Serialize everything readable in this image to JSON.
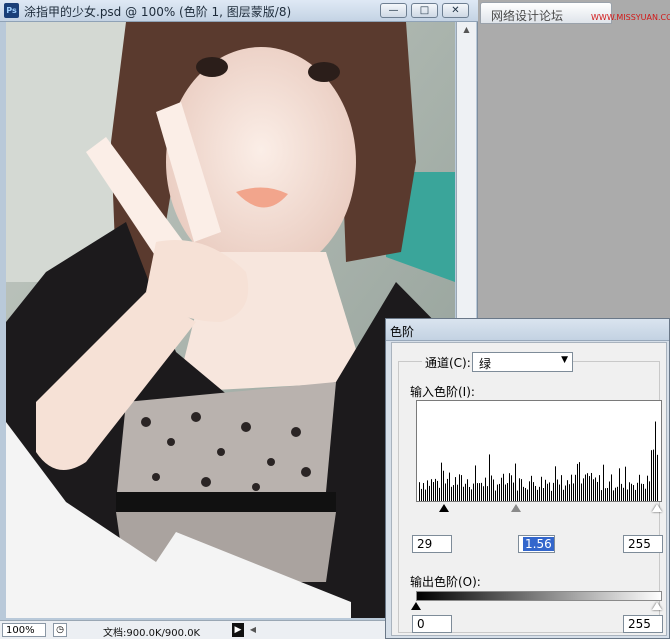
{
  "document": {
    "title": "涂指甲的少女.psd @ 100% (色阶 1, 图层蒙版/8)",
    "app_icon": "Ps",
    "window_controls": {
      "minimize": "—",
      "maximize": "□",
      "close": "✕"
    }
  },
  "status": {
    "zoom": "100%",
    "doc_size": "文档:900.0K/900.0K"
  },
  "panel": {
    "tab_label": "网络设计论坛",
    "watermark": "WWW.MISSYUAN.COM"
  },
  "levels": {
    "title": "色阶",
    "channel_label": "通道(C):",
    "channel_value": "绿",
    "input_label": "输入色阶(I):",
    "input_black": "29",
    "input_gamma": "1.56",
    "input_white": "255",
    "output_label": "输出色阶(O):",
    "output_black": "0",
    "output_white": "255"
  },
  "colors": {
    "titlebar": "#c4d3e4",
    "dialog_frame": "#d6dfe9",
    "selection": "#3366cc"
  }
}
